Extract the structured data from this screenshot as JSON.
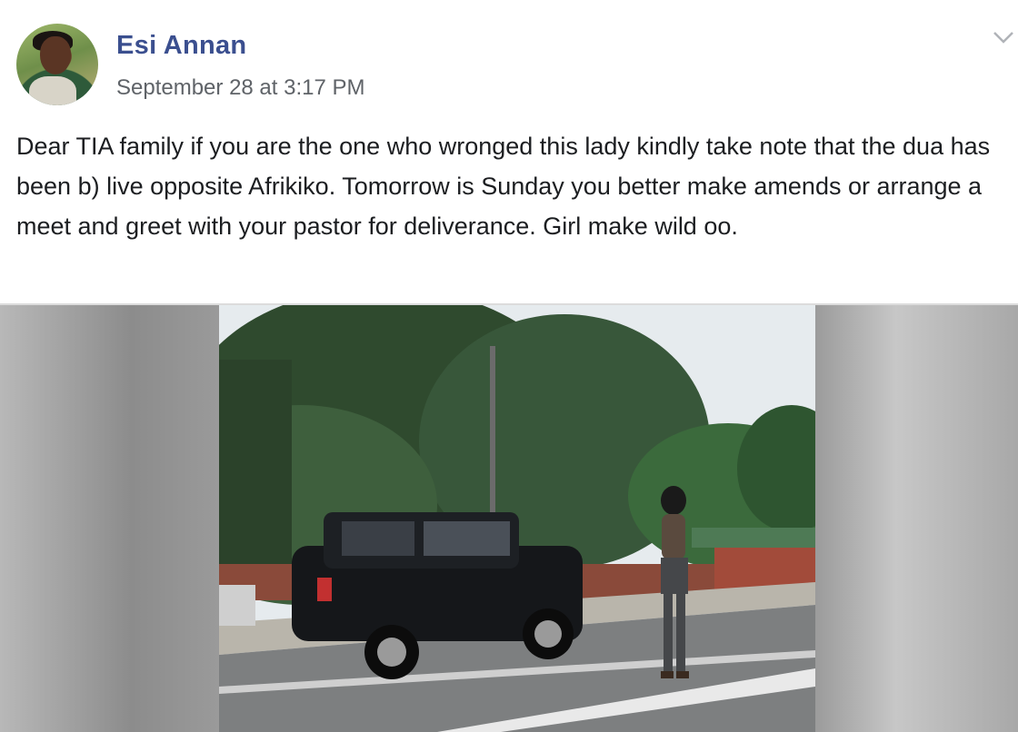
{
  "post": {
    "author": "Esi Annan",
    "timestamp": "September 28 at 3:17 PM",
    "text": "Dear TIA family if you are the one who wronged this lady kindly take note that the dua has been b) live opposite Afrikiko. Tomorrow is Sunday you better make amends or arrange a meet and greet with your pastor for deliverance. Girl make wild oo.",
    "menu_icon": "chevron-down-icon"
  },
  "colors": {
    "author_name": "#3b4f8f",
    "timestamp": "#5f6368",
    "body_text": "#1c1e21"
  }
}
